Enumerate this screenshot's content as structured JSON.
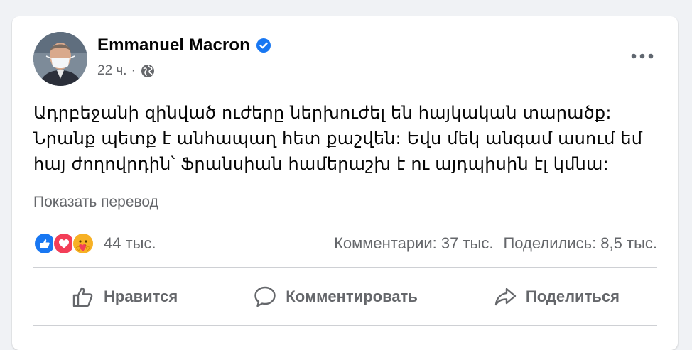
{
  "post": {
    "author_name": "Emmanuel Macron",
    "timestamp": "22 ч.",
    "separator": "·",
    "text_lines": [
      "Ադրբեջանի զինված ուժերը ներխուժել են հայկական տարածք:",
      "Նրանք պետք է անհապաղ հետ քաշվեն: Եվս մեկ անգամ ասում եմ",
      "հայ ժողովրդին՝ Ֆրանսիան համերաշխ է ու այդպիսին էլ կմնա:"
    ],
    "translate_link": "Показать перевод"
  },
  "stats": {
    "reactions": [
      "like-icon",
      "love-icon",
      "care-icon"
    ],
    "reaction_count": "44 тыс.",
    "comments": "Комментарии: 37 тыс.",
    "shares": "Поделились: 8,5 тыс."
  },
  "actions": {
    "like_label": "Нравится",
    "comment_label": "Комментировать",
    "share_label": "Поделиться"
  },
  "colors": {
    "accent": "#1877f2",
    "love": "#f33e58",
    "care": "#f7b125",
    "secondary_text": "#65676b"
  }
}
